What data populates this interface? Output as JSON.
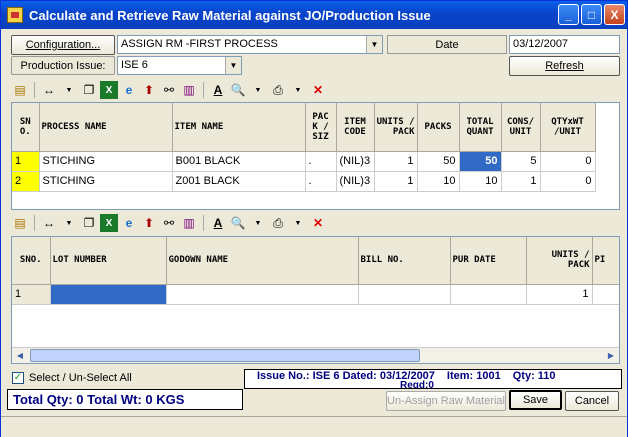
{
  "window": {
    "title": "Calculate and Retrieve Raw Material against JO/Production Issue",
    "minimize": "_",
    "maximize": "□",
    "close": "X"
  },
  "header": {
    "config_button": "Configuration...",
    "config_value": "ASSIGN RM -FIRST PROCESS",
    "date_label": "Date",
    "date_value": "03/12/2007",
    "production_issue_label": "Production Issue:",
    "production_issue_value": "ISE 6",
    "refresh_button": "Refresh"
  },
  "upper_grid": {
    "headers": [
      "SN O.",
      "PROCESS NAME",
      "ITEM NAME",
      "PAC K / SIZ",
      "ITEM CODE",
      "UNITS / PACK",
      "PACKS",
      "TOTAL QUANT",
      "CONS/ UNIT",
      "QTYxWT /UNIT"
    ],
    "rows": [
      {
        "sno": "1",
        "process": "STICHING",
        "item": "B001 BLACK",
        "pack": ".",
        "code": "(NIL)3",
        "units": "1",
        "packs": "50",
        "total": "50",
        "cons": "5",
        "qty": "0"
      },
      {
        "sno": "2",
        "process": "STICHING",
        "item": "Z001 BLACK",
        "pack": ".",
        "code": "(NIL)3",
        "units": "1",
        "packs": "10",
        "total": "10",
        "cons": "1",
        "qty": "0"
      }
    ]
  },
  "lower_grid": {
    "headers": [
      "SNO.",
      "LOT NUMBER",
      "GODOWN NAME",
      "BILL NO.",
      "PUR DATE",
      "UNITS / PACK",
      "PI"
    ],
    "rows": [
      {
        "sno": "1",
        "lot": "",
        "godown": "",
        "bill": "",
        "pur": "",
        "units": "1",
        "pi": ""
      }
    ]
  },
  "footer": {
    "select_all_label": "Select / Un-Select All",
    "issue_info": "Issue No.: ISE 6 Dated: 03/12/2007",
    "item_info": "Item: 1001",
    "qty_info": "Qty: 110",
    "reqd_info": "Reqd:0",
    "total_info": "Total Qty: 0 Total Wt: 0 KGS",
    "unassign_button": "Un-Assign Raw Material",
    "save_button": "Save",
    "cancel_button": "Cancel"
  },
  "colors": {
    "title_blue": "#0843c9",
    "row_highlight": "#ffff00",
    "cell_selected": "#316ac5",
    "info_text": "#000080"
  }
}
